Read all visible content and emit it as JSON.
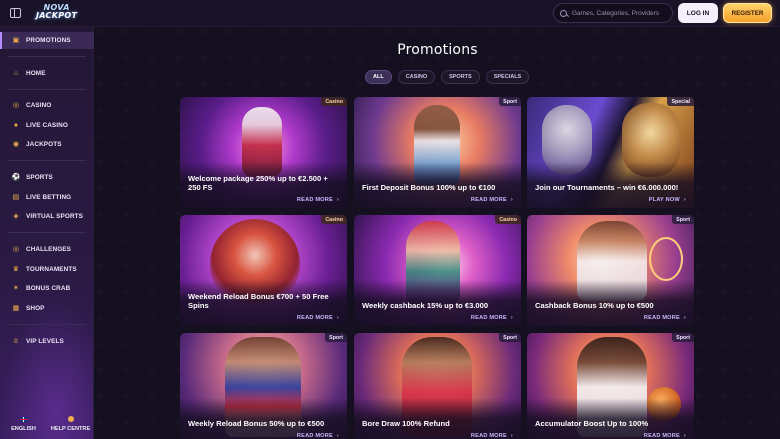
{
  "header": {
    "logo_line1": "NOVA",
    "logo_line2": "JACKPOT",
    "search_placeholder": "Games, Categories, Providers",
    "login_label": "LOG IN",
    "register_label": "REGISTER"
  },
  "sidebar": {
    "items": [
      {
        "label": "PROMOTIONS",
        "icon": "gift-icon"
      },
      {
        "label": "HOME",
        "icon": "home-icon"
      },
      {
        "label": "CASINO",
        "icon": "casino-chip-icon"
      },
      {
        "label": "LIVE CASINO",
        "icon": "spade-icon"
      },
      {
        "label": "JACKPOTS",
        "icon": "coin-icon"
      },
      {
        "label": "SPORTS",
        "icon": "ball-icon"
      },
      {
        "label": "LIVE BETTING",
        "icon": "live-screen-icon"
      },
      {
        "label": "VIRTUAL SPORTS",
        "icon": "controller-icon"
      },
      {
        "label": "CHALLENGES",
        "icon": "target-icon"
      },
      {
        "label": "TOURNAMENTS",
        "icon": "trophy-icon"
      },
      {
        "label": "BONUS CRAB",
        "icon": "crab-icon"
      },
      {
        "label": "SHOP",
        "icon": "bag-icon"
      },
      {
        "label": "VIP LEVELS",
        "icon": "crown-icon"
      }
    ],
    "footer": {
      "language_label": "ENGLISH",
      "help_label": "HELP CENTRE"
    }
  },
  "main": {
    "title": "Promotions",
    "filters": [
      "ALL",
      "CASINO",
      "SPORTS",
      "SPECIALS"
    ],
    "active_filter": "ALL",
    "cards": [
      {
        "badge": "Casino",
        "title": "Welcome package 250% up to €2.500 + 250 FS",
        "cta": "READ MORE"
      },
      {
        "badge": "Sport",
        "title": "First Deposit Bonus 100% up to €100",
        "cta": "READ MORE"
      },
      {
        "badge": "Special",
        "title": "Join our Tournaments – win €6.000.000!",
        "cta": "PLAY NOW"
      },
      {
        "badge": "Casino",
        "title": "Weekend Reload Bonus €700 + 50 Free Spins",
        "cta": "READ MORE"
      },
      {
        "badge": "Casino",
        "title": "Weekly cashback 15% up to €3.000",
        "cta": "READ MORE"
      },
      {
        "badge": "Sport",
        "title": "Cashback Bonus 10% up to €500",
        "cta": "READ MORE"
      },
      {
        "badge": "Sport",
        "title": "Weekly Reload Bonus 50% up to €500",
        "cta": "READ MORE"
      },
      {
        "badge": "Sport",
        "title": "Bore Draw 100% Refund",
        "cta": "READ MORE"
      },
      {
        "badge": "Sport",
        "title": "Accumulator Boost Up to 100%",
        "cta": "READ MORE"
      }
    ]
  },
  "colors": {
    "accent": "#b48cff",
    "register_gold": "#f6a02a",
    "background": "#15101f"
  }
}
